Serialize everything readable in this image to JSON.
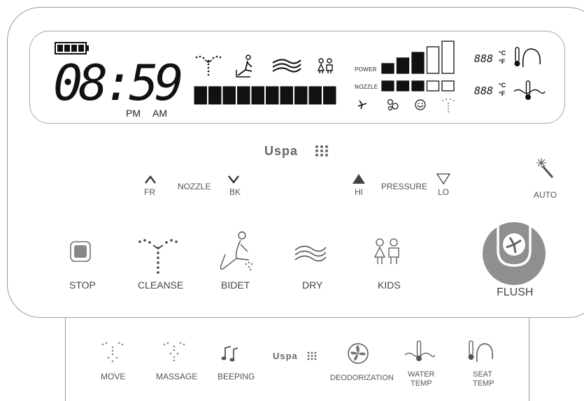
{
  "lcd": {
    "time": "08:59",
    "pm_label": "PM",
    "am_label": "AM",
    "power_label": "POWER",
    "nozzle_label": "NOZZLE",
    "seat_temp_readout": "888",
    "water_temp_readout": "888",
    "unit_c": "°C",
    "unit_f": "°F",
    "power_level": 3,
    "power_max": 5,
    "nozzle_level": 3,
    "nozzle_max": 5,
    "progress_level": 10,
    "progress_max": 10,
    "battery_level": 4,
    "battery_max": 4
  },
  "brand": "Uspa",
  "nozzle": {
    "label": "NOZZLE",
    "front_label": "FR",
    "back_label": "BK"
  },
  "pressure": {
    "label": "PRESSURE",
    "high_label": "HI",
    "low_label": "LO"
  },
  "auto_label": "AUTO",
  "main_buttons": {
    "stop": "STOP",
    "cleanse": "CLEANSE",
    "bidet": "BIDET",
    "dry": "DRY",
    "kids": "KIDS",
    "flush": "FLUSH"
  },
  "secondary_buttons": {
    "move": "MOVE",
    "massage": "MASSAGE",
    "beeping": "BEEPING",
    "deodorization": "DEODORIZATION",
    "water_temp_1": "WATER",
    "water_temp_2": "TEMP",
    "seat_temp_1": "SEAT",
    "seat_temp_2": "TEMP"
  },
  "icons": [
    "battery-icon",
    "cleanse-icon",
    "bidet-icon",
    "dry-icon",
    "kids-icon",
    "fan-icon",
    "bubbles-icon",
    "smile-icon",
    "spray-icon",
    "seat-temp-icon",
    "water-temp-icon",
    "wand-icon",
    "stop-icon",
    "flush-icon",
    "music-icon"
  ]
}
